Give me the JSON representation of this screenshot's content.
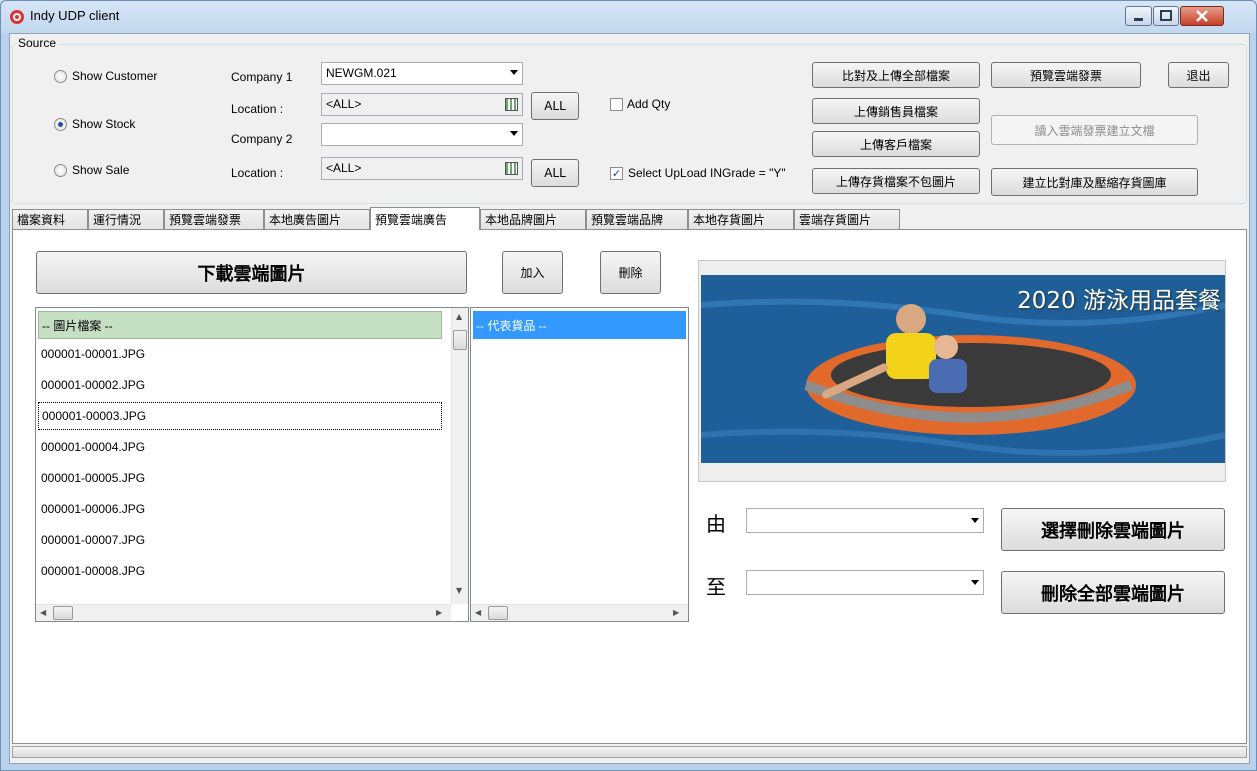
{
  "window": {
    "title": "Indy UDP client"
  },
  "source": {
    "group_label": "Source",
    "radios": [
      {
        "label": "Show Customer",
        "checked": false
      },
      {
        "label": "Show Stock",
        "checked": true
      },
      {
        "label": "Show Sale",
        "checked": false
      }
    ],
    "company1_label": "Company 1",
    "company1_value": "NEWGM.021",
    "location1_label": "Location :",
    "location1_value": "<ALL>",
    "company2_label": "Company 2",
    "company2_value": "",
    "location2_label": "Location :",
    "location2_value": "<ALL>",
    "all_button": "ALL",
    "add_qty_label": "Add Qty",
    "add_qty_checked": false,
    "select_upload_label": "Select UpLoad INGrade = \"Y\"",
    "select_upload_checked": true
  },
  "toolbar": {
    "compare_upload_all": "比對及上傳全部檔案",
    "upload_salesperson": "上傳銷售員檔案",
    "upload_customer": "上傳客戶檔案",
    "upload_stock_no_img": "上傳存貨檔案不包圖片",
    "preview_cloud_invoice": "預覽雲端發票",
    "read_cloud_invoice": "讀入雲端發票建立文檔",
    "build_compare_db": "建立比對庫及壓縮存貨圖庫",
    "exit": "退出"
  },
  "tabs": [
    {
      "label": "檔案資料",
      "active": false
    },
    {
      "label": "運行情況",
      "active": false
    },
    {
      "label": "預覽雲端發票",
      "active": false
    },
    {
      "label": "本地廣告圖片",
      "active": false
    },
    {
      "label": "預覽雲端廣告",
      "active": true
    },
    {
      "label": "本地品牌圖片",
      "active": false
    },
    {
      "label": "預覽雲端品牌",
      "active": false
    },
    {
      "label": "本地存貨圖片",
      "active": false
    },
    {
      "label": "雲端存貨圖片",
      "active": false
    }
  ],
  "panel": {
    "download_button": "下載雲端圖片",
    "add_button": "加入",
    "delete_button": "刪除",
    "image_list_header": "-- 圖片檔案 --",
    "image_files": [
      "000001-00001.JPG",
      "000001-00002.JPG",
      "000001-00003.JPG",
      "000001-00004.JPG",
      "000001-00005.JPG",
      "000001-00006.JPG",
      "000001-00007.JPG",
      "000001-00008.JPG"
    ],
    "product_list_header": "-- 代表貨品 --",
    "banner_text": "2020 游泳用品套餐",
    "from_label": "由",
    "to_label": "至",
    "from_value": "",
    "to_value": "",
    "delete_selected_button": "選擇刪除雲端圖片",
    "delete_all_button": "刪除全部雲端圖片"
  },
  "colors": {
    "list_header_bg": "#c6e0c4",
    "list_selected_bg": "#3399ff",
    "close_button": "#c5422a"
  }
}
